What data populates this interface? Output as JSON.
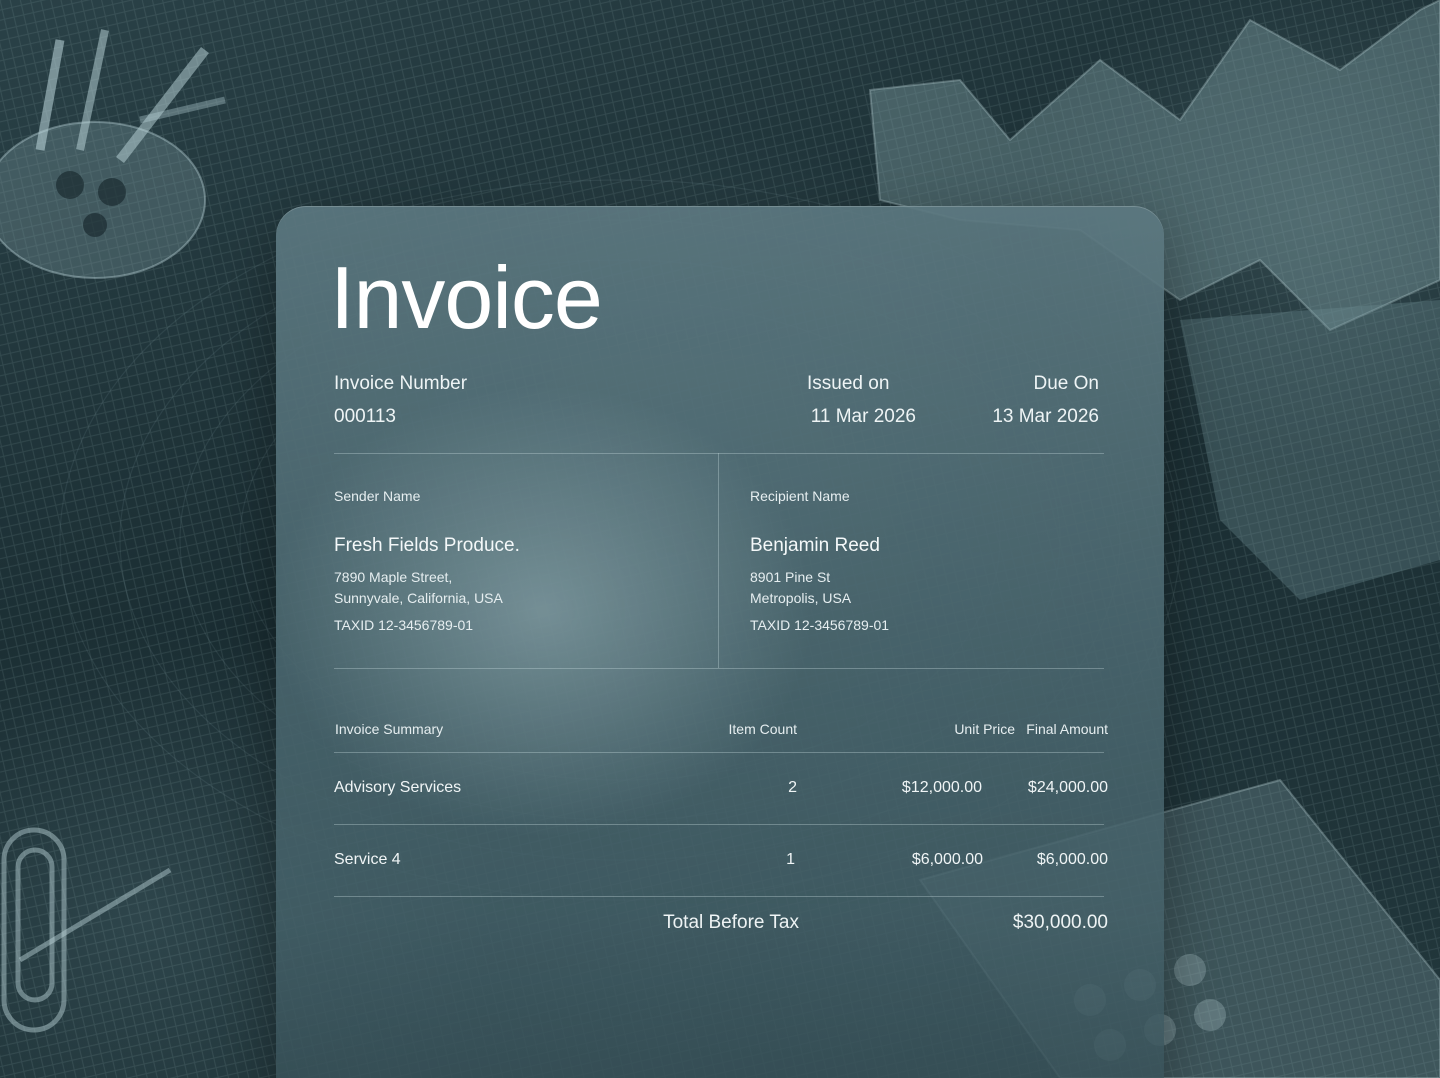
{
  "invoice": {
    "title": "Invoice",
    "number_label": "Invoice Number",
    "number_value": "000113",
    "issued_label": "Issued on",
    "issued_value": "11 Mar 2026",
    "due_label": "Due On",
    "due_value": "13 Mar 2026"
  },
  "sender": {
    "label": "Sender Name",
    "name": "Fresh Fields Produce.",
    "address_line1": "7890 Maple Street,",
    "address_line2": "Sunnyvale, California, USA",
    "tax_id": "TAXID 12-3456789-01"
  },
  "recipient": {
    "label": "Recipient Name",
    "name": "Benjamin Reed",
    "address_line1": "8901 Pine St",
    "address_line2": "Metropolis, USA",
    "tax_id": "TAXID 12-3456789-01"
  },
  "summary": {
    "headers": {
      "description": "Invoice Summary",
      "count": "Item Count",
      "unit_price": "Unit Price",
      "final_amount": "Final Amount"
    },
    "rows": [
      {
        "description": "Advisory Services",
        "count": "2",
        "unit_price": "$12,000.00",
        "final_amount": "$24,000.00"
      },
      {
        "description": "Service 4",
        "count": "1",
        "unit_price": "$6,000.00",
        "final_amount": "$6,000.00"
      }
    ],
    "total_label": "Total Before Tax",
    "total_value": "$30,000.00"
  },
  "colors": {
    "background": "#1f3338",
    "card": "#5c7880",
    "text": "#ffffff"
  }
}
